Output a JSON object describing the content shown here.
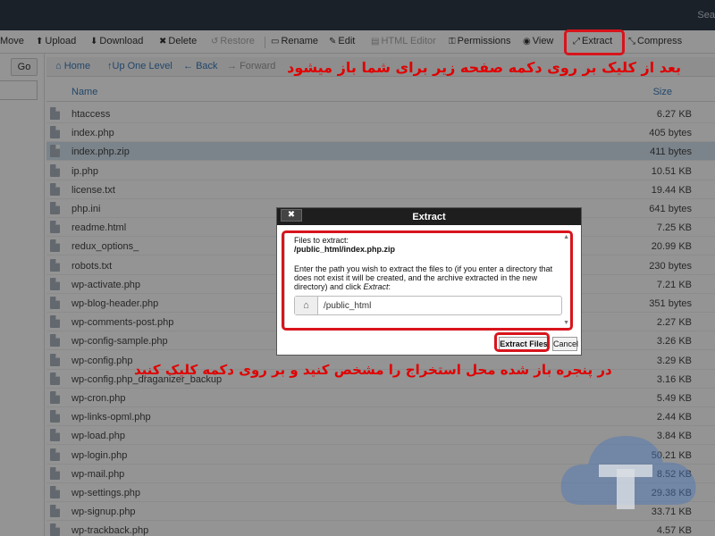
{
  "topbar": {
    "search_label": "Sea"
  },
  "toolbar": {
    "move": "Move",
    "upload": "Upload",
    "download": "Download",
    "delete": "Delete",
    "restore": "Restore",
    "rename": "Rename",
    "edit": "Edit",
    "html_editor": "HTML Editor",
    "permissions": "Permissions",
    "view": "View",
    "extract": "Extract",
    "compress": "Compress"
  },
  "leftpane": {
    "go_label": "Go"
  },
  "navbar": {
    "home": "Home",
    "up_one_level": "Up One Level",
    "back": "Back",
    "forward": "Forward"
  },
  "table": {
    "col_name": "Name",
    "col_size": "Size",
    "rows": [
      {
        "name": "htaccess",
        "size": "6.27 KB"
      },
      {
        "name": "index.php",
        "size": "405 bytes"
      },
      {
        "name": "index.php.zip",
        "size": "411 bytes"
      },
      {
        "name": "ip.php",
        "size": "10.51 KB"
      },
      {
        "name": "license.txt",
        "size": "19.44 KB"
      },
      {
        "name": "php.ini",
        "size": "641 bytes"
      },
      {
        "name": "readme.html",
        "size": "7.25 KB"
      },
      {
        "name": "redux_options_",
        "size": "20.99 KB"
      },
      {
        "name": "robots.txt",
        "size": "230 bytes"
      },
      {
        "name": "wp-activate.php",
        "size": "7.21 KB"
      },
      {
        "name": "wp-blog-header.php",
        "size": "351 bytes"
      },
      {
        "name": "wp-comments-post.php",
        "size": "2.27 KB"
      },
      {
        "name": "wp-config-sample.php",
        "size": "3.26 KB"
      },
      {
        "name": "wp-config.php",
        "size": "3.29 KB"
      },
      {
        "name": "wp-config.php_draganizer_backup",
        "size": "3.16 KB"
      },
      {
        "name": "wp-cron.php",
        "size": "5.49 KB"
      },
      {
        "name": "wp-links-opml.php",
        "size": "2.44 KB"
      },
      {
        "name": "wp-load.php",
        "size": "3.84 KB"
      },
      {
        "name": "wp-login.php",
        "size": "50.21 KB"
      },
      {
        "name": "wp-mail.php",
        "size": "8.52 KB"
      },
      {
        "name": "wp-settings.php",
        "size": "29.38 KB"
      },
      {
        "name": "wp-signup.php",
        "size": "33.71 KB"
      },
      {
        "name": "wp-trackback.php",
        "size": "4.57 KB"
      }
    ]
  },
  "annotations": {
    "top": "بعد از کلیک بر روی دکمه صفحه زیر برای شما باز میشود",
    "bottom": "در پنجره باز شده محل استخراج را مشخص کنید و بر روی دکمه کلیک کنید"
  },
  "dialog": {
    "title": "Extract",
    "close_label": "✖",
    "files_label": "Files to extract:",
    "file_path": "/public_html/index.php.zip",
    "instructions_1": "Enter the path you wish to extract the files to (if you enter a directory that",
    "instructions_2": "does not exist it will be created, and the archive extracted in the new",
    "instructions_3": "directory) and click ",
    "instructions_em": "Extract",
    "instructions_end": ":",
    "path_value": "/public_html",
    "extract_button": "Extract Files",
    "cancel_button": "Cancel"
  },
  "colors": {
    "highlight": "#d8141c",
    "annotation_text": "#e00000",
    "topbar": "#2f3a47",
    "link_blue": "#3a7ab8",
    "selected_row": "#d4e3ef"
  },
  "icons": {
    "upload": "upload-icon",
    "download": "download-icon",
    "delete": "x-icon",
    "restore": "restore-icon",
    "rename": "rename-icon",
    "edit": "pencil-icon",
    "html_editor": "html-icon",
    "permissions": "key-icon",
    "view": "eye-icon",
    "extract": "extract-arrows-icon",
    "compress": "compress-arrows-icon",
    "home": "home-icon",
    "up": "up-arrow-icon",
    "back": "left-arrow-icon",
    "forward": "right-arrow-icon",
    "file": "file-icon"
  }
}
